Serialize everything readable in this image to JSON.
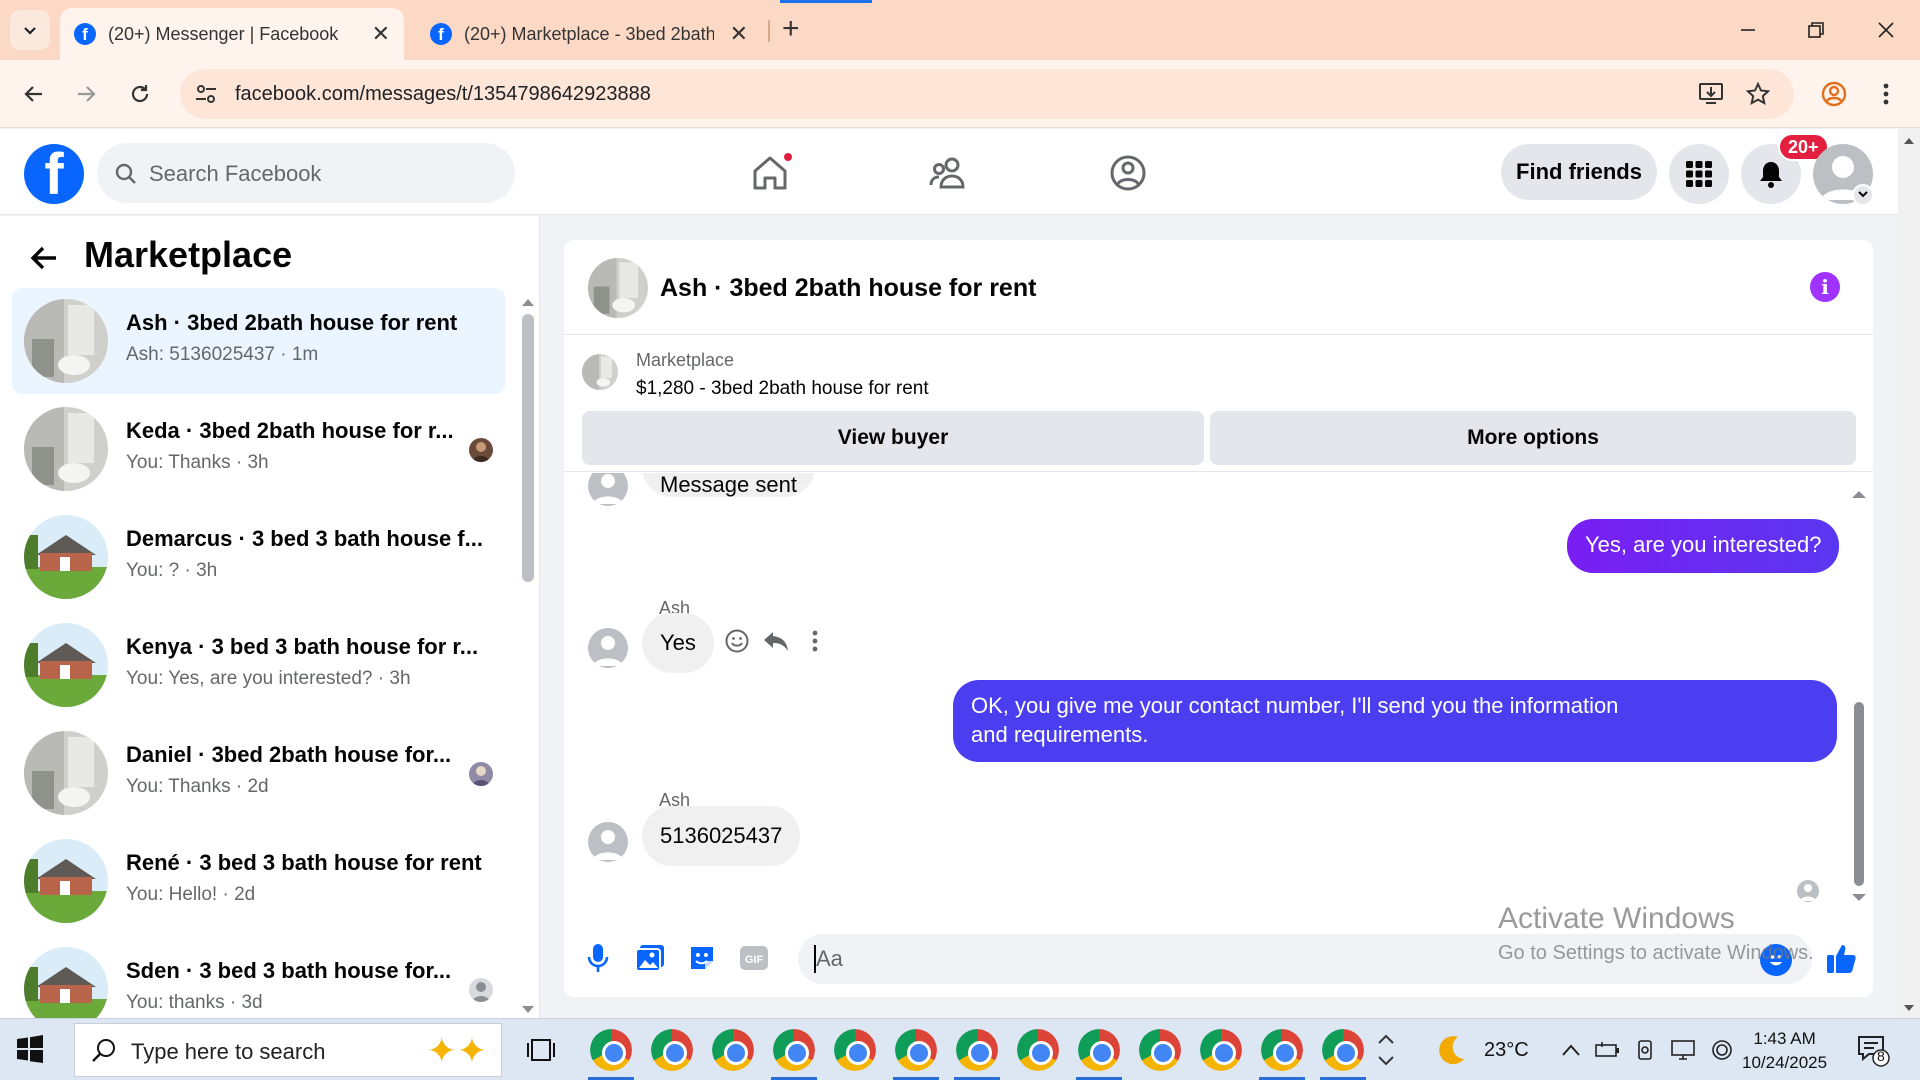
{
  "browser": {
    "tabs": [
      {
        "title": "(20+) Messenger | Facebook",
        "active": true
      },
      {
        "title": "(20+) Marketplace - 3bed 2bath",
        "active": false
      }
    ],
    "url": "facebook.com/messages/t/1354798642923888"
  },
  "header": {
    "search_placeholder": "Search Facebook",
    "find_friends": "Find friends",
    "notif_count": "20+",
    "brand_color": "#0866ff"
  },
  "sidebar": {
    "title": "Marketplace",
    "conversations": [
      {
        "title": "Ash · 3bed 2bath house for rent",
        "sub": "Ash: 5136025437 · 1m",
        "thumb": "bathroom",
        "selected": true
      },
      {
        "title": "Keda · 3bed 2bath house for r...",
        "sub": "You: Thanks · 3h",
        "thumb": "bathroom"
      },
      {
        "title": "Demarcus · 3 bed 3 bath house f...",
        "sub": "You: ? · 3h",
        "thumb": "house"
      },
      {
        "title": "Kenya · 3 bed 3 bath house for r...",
        "sub": "You: Yes, are you interested? · 3h",
        "thumb": "house"
      },
      {
        "title": "Daniel · 3bed 2bath house for...",
        "sub": "You: Thanks · 2d",
        "thumb": "bathroom"
      },
      {
        "title": "René · 3 bed 3 bath house for rent",
        "sub": "You: Hello! · 2d",
        "thumb": "house"
      },
      {
        "title": "Sden · 3 bed 3 bath house for...",
        "sub": "You: thanks · 3d",
        "thumb": "house"
      }
    ]
  },
  "chat": {
    "title": "Ash · 3bed 2bath house for rent",
    "marketplace_label": "Marketplace",
    "listing": "$1,280 - 3bed 2bath house for rent",
    "view_buyer": "View buyer",
    "more_options": "More options",
    "partial_message": "Message sent",
    "messages": {
      "out1": "Yes, are you interested?",
      "sender1": "Ash",
      "in1": "Yes",
      "out2_line1": "OK, you give me your contact number, I'll send you the information",
      "out2_line2": "and requirements.",
      "sender2": "Ash",
      "in2": "5136025437"
    },
    "composer_placeholder": "Aa"
  },
  "watermark": {
    "line1": "Activate Windows",
    "line2": "Go to Settings to activate Windows."
  },
  "taskbar": {
    "search_placeholder": "Type here to search",
    "weather": "23°C",
    "time": "1:43 AM",
    "date": "10/24/2025",
    "notification_count": "8"
  }
}
